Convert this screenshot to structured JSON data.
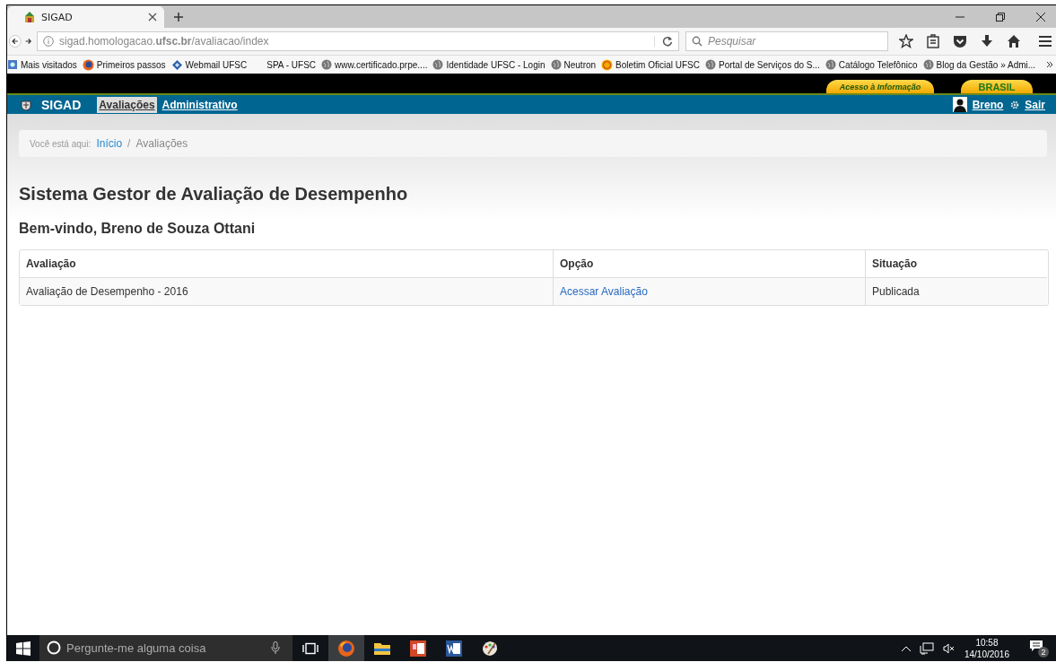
{
  "browser": {
    "tab": {
      "title": "SIGAD",
      "selected": true
    },
    "url": "sigad.homologacao.**ufsc.br**/avaliacao/index",
    "search": {
      "placeholder": "Pesquisar"
    },
    "bookmarks": [
      {
        "label": "Mais visitados",
        "kind": "folder"
      },
      {
        "label": "Primeiros passos",
        "kind": "firefox"
      },
      {
        "label": "Webmail UFSC",
        "kind": "mail"
      },
      {
        "label": "SPA - UFSC",
        "kind": "none"
      },
      {
        "label": "www.certificado.prpe....",
        "kind": "globe"
      },
      {
        "label": "Identidade UFSC - Login",
        "kind": "globe"
      },
      {
        "label": "Neutron",
        "kind": "globe"
      },
      {
        "label": "Boletim Oficial UFSC",
        "kind": "badge"
      },
      {
        "label": "Portal de Serviços do S...",
        "kind": "globe"
      },
      {
        "label": "Catálogo Telefônico",
        "kind": "globe"
      },
      {
        "label": "Blog da Gestão » Admi...",
        "kind": "globe"
      }
    ]
  },
  "gov_bar": {
    "access_link": "Acesso à Informação",
    "brasil_link": "BRASIL"
  },
  "navbar": {
    "brand": "SIGAD",
    "menu": [
      {
        "label": "Avaliações",
        "selected": true
      },
      {
        "label": "Administrativo",
        "selected": false
      }
    ],
    "user": "Breno",
    "logout": "Sair"
  },
  "breadcrumb": {
    "prefix": "Você está aqui:",
    "separator": "/",
    "items": [
      {
        "label": "Início",
        "link": true
      },
      {
        "label": "Avaliações",
        "link": false
      }
    ]
  },
  "title": "Sistema Gestor de Avaliação de Desempenho",
  "welcome": "Bem-vindo, Breno de Souza Ottani",
  "table": {
    "columns": [
      "Avaliação",
      "Opção",
      "Situação"
    ],
    "rows": [
      [
        {
          "text": "Avaliação de Desempenho - 2016",
          "kind": "text"
        },
        {
          "text": "Acessar Avaliação",
          "kind": "link"
        },
        {
          "text": "Publicada",
          "kind": "text"
        }
      ]
    ]
  },
  "taskbar": {
    "search": {
      "placeholder": "Pergunte-me alguma coisa"
    },
    "apps": [
      {
        "kind": "firefox",
        "selected": true
      },
      {
        "kind": "explorer",
        "selected": false
      },
      {
        "kind": "powerpoint",
        "selected": false
      },
      {
        "kind": "word",
        "selected": false
      },
      {
        "kind": "paint",
        "selected": false
      }
    ],
    "time": "10:58",
    "date": "14/10/2016",
    "notifications": "2"
  }
}
